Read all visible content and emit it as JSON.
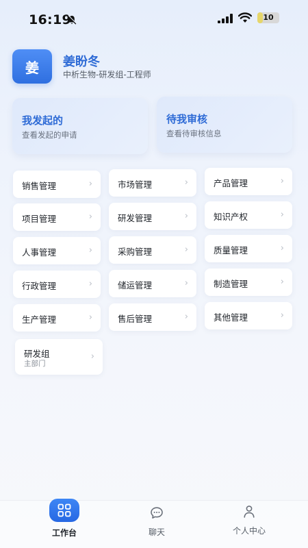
{
  "status_bar": {
    "time": "16:19",
    "battery": "10",
    "battery_level_percent": 10,
    "icons": [
      "bell-off-icon",
      "signal-icon",
      "wifi-icon",
      "battery-icon"
    ]
  },
  "profile": {
    "avatar_text": "姜",
    "name": "姜盼冬",
    "role": "中析生物-研发组-工程师"
  },
  "quick_actions": [
    {
      "title": "我发起的",
      "subtitle": "查看发起的申请"
    },
    {
      "title": "待我审核",
      "subtitle": "查看待审核信息"
    }
  ],
  "modules": [
    {
      "label": "销售管理"
    },
    {
      "label": "市场管理"
    },
    {
      "label": "产品管理"
    },
    {
      "label": "项目管理"
    },
    {
      "label": "研发管理"
    },
    {
      "label": "知识产权"
    },
    {
      "label": "人事管理"
    },
    {
      "label": "采购管理"
    },
    {
      "label": "质量管理"
    },
    {
      "label": "行政管理"
    },
    {
      "label": "储运管理"
    },
    {
      "label": "制造管理"
    },
    {
      "label": "生产管理"
    },
    {
      "label": "售后管理"
    },
    {
      "label": "其他管理"
    }
  ],
  "department": {
    "label": "研发组",
    "subtitle": "主部门"
  },
  "chevron": "›",
  "bottom_nav": [
    {
      "label": "工作台",
      "icon": "grid-icon",
      "active": true
    },
    {
      "label": "聊天",
      "icon": "chat-bubble-icon",
      "active": false
    },
    {
      "label": "个人中心",
      "icon": "person-icon",
      "active": false
    }
  ],
  "colors": {
    "accent": "#2e6bd6",
    "active_tab": "#2768e3",
    "battery_fill": "#e6d66a"
  }
}
